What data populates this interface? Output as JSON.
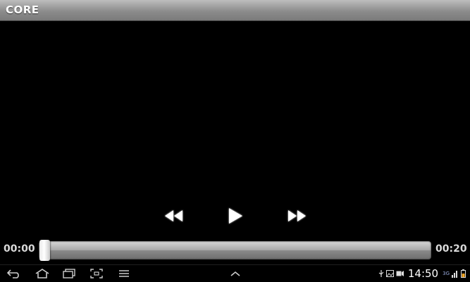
{
  "app": {
    "title": "CORE"
  },
  "player": {
    "current_time": "00:00",
    "total_time": "00:20",
    "progress": 0.0
  },
  "controls": [
    "rewind-icon",
    "play-icon",
    "fast-forward-icon"
  ],
  "status_bar": {
    "time": "14:50",
    "network": "3G"
  },
  "colors": {
    "background": "#000000",
    "title_bar": "#9e9e9e",
    "text": "#ffffff"
  }
}
